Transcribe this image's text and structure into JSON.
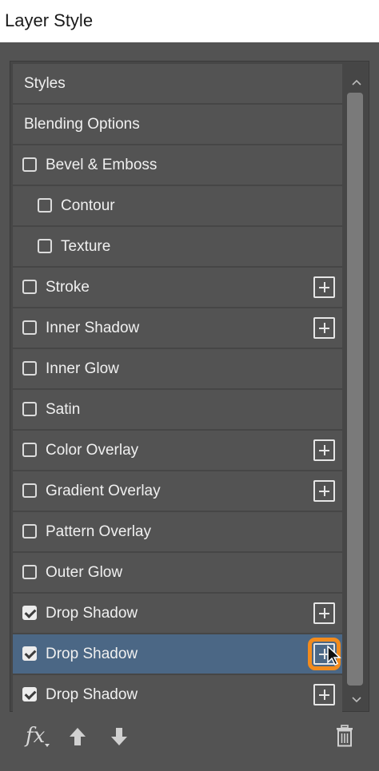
{
  "window": {
    "title": "Layer Style"
  },
  "rows": [
    {
      "label": "Styles",
      "checkbox": "none",
      "plus": false,
      "indent": 0
    },
    {
      "label": "Blending Options",
      "checkbox": "none",
      "plus": false,
      "indent": 0
    },
    {
      "label": "Bevel & Emboss",
      "checkbox": "unchecked",
      "plus": false,
      "indent": 0
    },
    {
      "label": "Contour",
      "checkbox": "unchecked",
      "plus": false,
      "indent": 1
    },
    {
      "label": "Texture",
      "checkbox": "unchecked",
      "plus": false,
      "indent": 1
    },
    {
      "label": "Stroke",
      "checkbox": "unchecked",
      "plus": true,
      "indent": 0
    },
    {
      "label": "Inner Shadow",
      "checkbox": "unchecked",
      "plus": true,
      "indent": 0
    },
    {
      "label": "Inner Glow",
      "checkbox": "unchecked",
      "plus": false,
      "indent": 0
    },
    {
      "label": "Satin",
      "checkbox": "unchecked",
      "plus": false,
      "indent": 0
    },
    {
      "label": "Color Overlay",
      "checkbox": "unchecked",
      "plus": true,
      "indent": 0
    },
    {
      "label": "Gradient Overlay",
      "checkbox": "unchecked",
      "plus": true,
      "indent": 0
    },
    {
      "label": "Pattern Overlay",
      "checkbox": "unchecked",
      "plus": false,
      "indent": 0
    },
    {
      "label": "Outer Glow",
      "checkbox": "unchecked",
      "plus": false,
      "indent": 0
    },
    {
      "label": "Drop Shadow",
      "checkbox": "checked",
      "plus": true,
      "indent": 0
    },
    {
      "label": "Drop Shadow",
      "checkbox": "checked",
      "plus": true,
      "indent": 0,
      "selected": true,
      "highlight": true
    },
    {
      "label": "Drop Shadow",
      "checkbox": "checked",
      "plus": true,
      "indent": 0
    }
  ],
  "footer": {
    "fx_label": "fx",
    "icons": [
      "fx-menu-icon",
      "move-up-icon",
      "move-down-icon",
      "trash-icon"
    ]
  },
  "colors": {
    "panel_bg": "#535353",
    "selected_row": "#4b6785",
    "highlight_outline": "#f28b1d"
  }
}
